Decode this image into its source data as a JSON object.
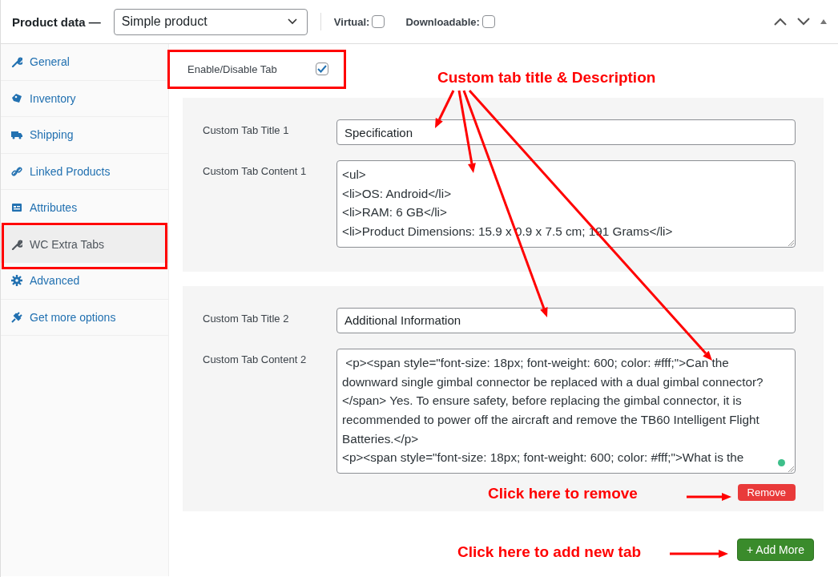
{
  "header": {
    "title": "Product data —",
    "product_type": "Simple product",
    "options": [
      {
        "label": "Virtual:",
        "checked": false
      },
      {
        "label": "Downloadable:",
        "checked": false
      }
    ]
  },
  "sidebar": {
    "items": [
      {
        "label": "General",
        "selected": false
      },
      {
        "label": "Inventory",
        "selected": false
      },
      {
        "label": "Shipping",
        "selected": false
      },
      {
        "label": "Linked Products",
        "selected": false
      },
      {
        "label": "Attributes",
        "selected": false
      },
      {
        "label": "WC Extra Tabs",
        "selected": true
      },
      {
        "label": "Advanced",
        "selected": false
      },
      {
        "label": "Get more options",
        "selected": false
      }
    ]
  },
  "enable_tab": {
    "label": "Enable/Disable Tab",
    "checked": true
  },
  "custom_tabs": [
    {
      "title_label": "Custom Tab Title 1",
      "title_value": "Specification",
      "content_label": "Custom Tab Content 1",
      "content_lines": [
        "<ul>",
        "<li>OS: Android</li>",
        "<li>RAM: 6 GB</li>",
        "<li>Product Dimensions: 15.9 x 0.9 x 7.5 cm; 191 Grams</li>"
      ]
    },
    {
      "title_label": "Custom Tab Title 2",
      "title_value": "Additional Information",
      "content_label": "Custom Tab Content 2",
      "content_lines": [
        " <p><span style=\"font-size: 18px; font-weight: 600; color: #fff;\">Can the downward single gimbal connector be replaced with a dual gimbal connector?</span> Yes. To ensure safety, before replacing the gimbal connector, it is recommended to power off the aircraft and remove the TB60 Intelligent Flight Batteries.</p>",
        "<p><span style=\"font-size: 18px; font-weight: 600; color: #fff;\">What is the"
      ],
      "remove_button": "Remove"
    }
  ],
  "add_button": "+ Add More",
  "annotations": [
    {
      "text": "Custom tab title & Description"
    },
    {
      "text": "Click here to remove"
    },
    {
      "text": "Click here to add new tab"
    }
  ]
}
